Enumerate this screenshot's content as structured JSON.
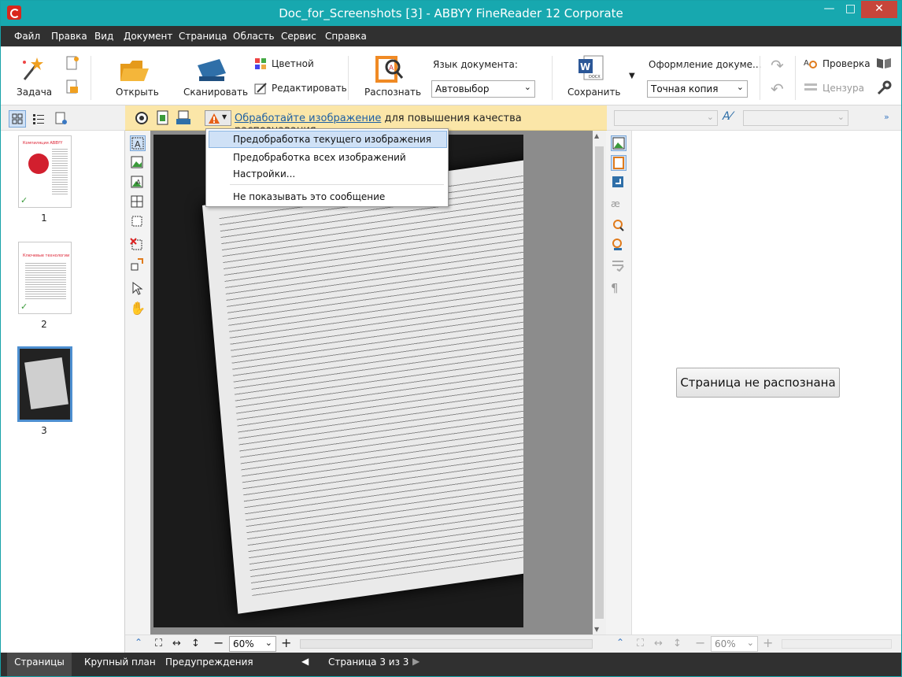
{
  "window": {
    "title": "Doc_for_Screenshots [3] - ABBYY FineReader 12 Corporate"
  },
  "menu": [
    "Файл",
    "Правка",
    "Вид",
    "Документ",
    "Страница",
    "Область",
    "Сервис",
    "Справка"
  ],
  "toolbar": {
    "task": "Задача",
    "open": "Открыть",
    "scan": "Сканировать",
    "color": "Цветной",
    "edit": "Редактировать",
    "recognize": "Распознать",
    "doc_lang_label": "Язык документа:",
    "doc_lang_value": "Автовыбор",
    "save": "Сохранить",
    "format_label": "Оформление докуме...",
    "format_value": "Точная копия",
    "check": "Проверка",
    "censor": "Цензура"
  },
  "info": {
    "link": "Обработайте изображение",
    "text": " для повышения качества распознавания."
  },
  "dropdown": [
    "Предобработка текущего изображения",
    "Предобработка всех изображений",
    "Настройки...",
    "Не показывать это сообщение"
  ],
  "pages": [
    "1",
    "2",
    "3"
  ],
  "thumb_titles": [
    "Компиляция ABBYY",
    "Ключевые технологии"
  ],
  "zoom": {
    "left": "60%",
    "right": "60%"
  },
  "right": {
    "not_recognized": "Страница не распознана"
  },
  "status": {
    "tab1": "Страницы",
    "tab2": "Крупный план",
    "tab3": "Предупреждения",
    "page_info": "Страница 3 из 3"
  },
  "colors": {
    "title": "#17a8af",
    "menu": "#303030",
    "info": "#fbe6a8",
    "accent": "#4d8fd0"
  }
}
